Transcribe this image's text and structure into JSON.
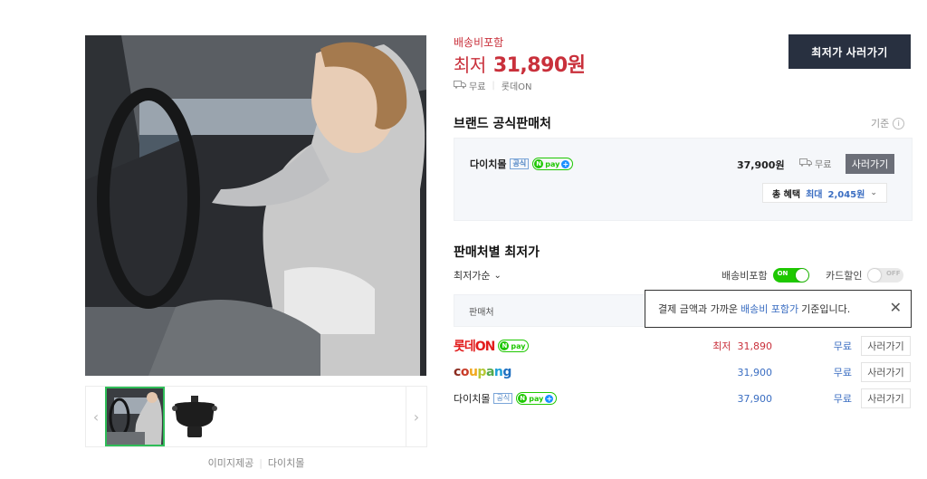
{
  "gallery": {
    "credit": "이미지제공",
    "credit_shop": "다이치몰"
  },
  "summary": {
    "shipping_included": "배송비포함",
    "lowest_label": "최저",
    "lowest_price": "31,890원",
    "delivery": "무료",
    "delivery_shop": "롯데ON",
    "buy_button": "최저가 사러가기"
  },
  "official": {
    "title": "브랜드 공식판매처",
    "basis": "기준",
    "shop_name": "다이치몰",
    "official_tag": "공식",
    "npay": "pay",
    "price": "37,900원",
    "ship": "무료",
    "buy": "사러가기",
    "benefit_label": "총 혜택",
    "benefit_max": "최대",
    "benefit_value": "2,045원"
  },
  "by_seller": {
    "title": "판매처별 최저가",
    "sort": "최저가순",
    "ship_toggle_label": "배송비포함",
    "ship_toggle_state": "ON",
    "card_toggle_label": "카드할인",
    "card_toggle_state": "OFF",
    "col_seller": "판매처",
    "tooltip_pre": "결제 금액과 가까운",
    "tooltip_hl": "배송비 포함가",
    "tooltip_post": "기준입니다.",
    "rows": [
      {
        "shop": "롯데ON",
        "low_label": "최저",
        "price": "31,890",
        "ship": "무료",
        "buy": "사러가기"
      },
      {
        "shop": "coupang",
        "price": "31,900",
        "ship": "무료",
        "buy": "사러가기"
      },
      {
        "shop": "다이치몰",
        "tag": "공식",
        "price": "37,900",
        "ship": "무료",
        "buy": "사러가기"
      }
    ]
  },
  "colors": {
    "price_red": "#c9303b",
    "link_blue": "#3b6ec2",
    "npay_green": "#1ec800",
    "dark_button": "#283040"
  }
}
